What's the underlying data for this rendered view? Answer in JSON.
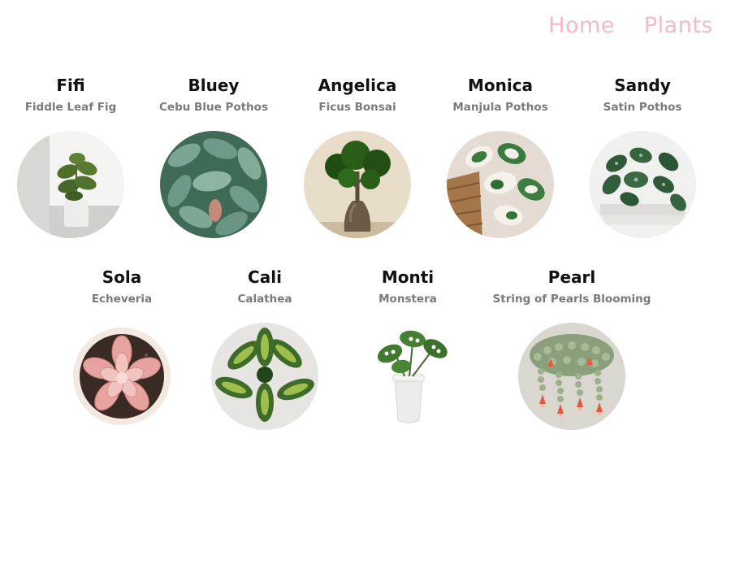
{
  "nav": {
    "items": [
      {
        "label": "Home"
      },
      {
        "label": "Plants"
      }
    ]
  },
  "plants": [
    {
      "name": "Fifi",
      "species": "Fiddle Leaf Fig",
      "icon": "fiddle-leaf-fig-photo"
    },
    {
      "name": "Bluey",
      "species": "Cebu Blue Pothos",
      "icon": "cebu-blue-pothos-photo"
    },
    {
      "name": "Angelica",
      "species": "Ficus Bonsai",
      "icon": "ficus-bonsai-photo"
    },
    {
      "name": "Monica",
      "species": "Manjula Pothos",
      "icon": "manjula-pothos-photo"
    },
    {
      "name": "Sandy",
      "species": "Satin Pothos",
      "icon": "satin-pothos-photo"
    },
    {
      "name": "Sola",
      "species": "Echeveria",
      "icon": "echeveria-photo"
    },
    {
      "name": "Cali",
      "species": "Calathea",
      "icon": "calathea-photo"
    },
    {
      "name": "Monti",
      "species": "Monstera",
      "icon": "monstera-photo"
    },
    {
      "name": "Pearl",
      "species": "String of Pearls Blooming",
      "icon": "string-of-pearls-photo"
    }
  ],
  "colors": {
    "nav": "#f6b9c5",
    "name": "#111111",
    "species": "#7a7a7a"
  }
}
